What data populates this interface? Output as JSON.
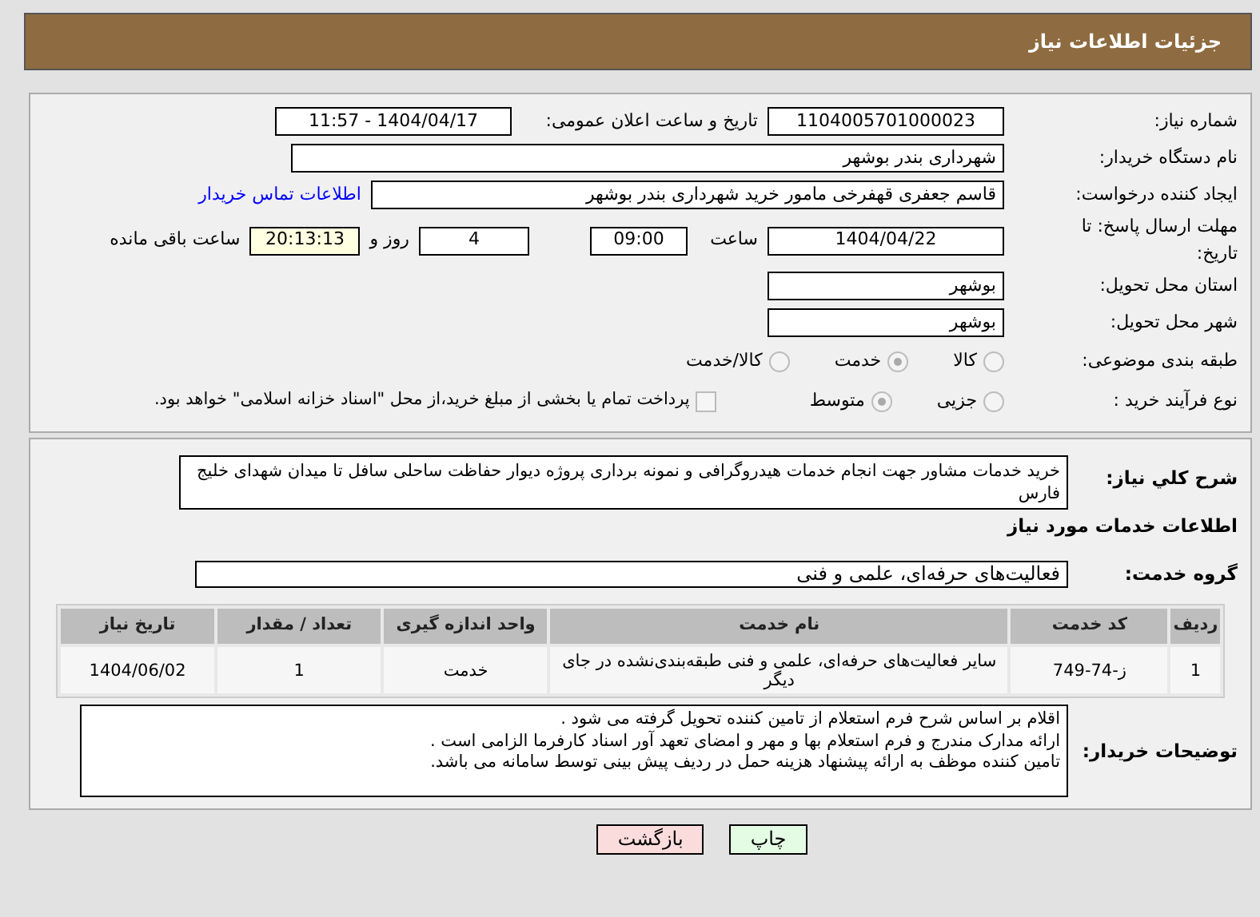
{
  "header": {
    "title": "جزئیات اطلاعات نیاز"
  },
  "need_number": {
    "label": "شماره نیاز:",
    "value": "1104005701000023"
  },
  "announce": {
    "label": "تاریخ و ساعت اعلان عمومی:",
    "value": "1404/04/17 - 11:57"
  },
  "buyer_org": {
    "label": "نام دستگاه خریدار:",
    "value": "شهرداری بندر بوشهر"
  },
  "requester": {
    "label": "ایجاد کننده درخواست:",
    "value": "قاسم جعفری قهفرخی مامور خرید  شهرداری بندر بوشهر",
    "contact_link": "اطلاعات تماس خریدار"
  },
  "deadline": {
    "label": "مهلت ارسال پاسخ: تا تاریخ:",
    "date": "1404/04/22",
    "time_label": "ساعت",
    "time": "09:00",
    "days": "4",
    "days_label": "روز و",
    "remaining": "20:13:13",
    "remaining_label": "ساعت باقی مانده"
  },
  "province": {
    "label": "استان محل تحویل:",
    "value": "بوشهر"
  },
  "city": {
    "label": "شهر محل تحویل:",
    "value": "بوشهر"
  },
  "category": {
    "label": "طبقه بندی موضوعی:",
    "options": [
      {
        "label": "کالا",
        "selected": false
      },
      {
        "label": "خدمت",
        "selected": true
      },
      {
        "label": "کالا/خدمت",
        "selected": false
      }
    ]
  },
  "process": {
    "label": "نوع فرآیند خرید :",
    "options": [
      {
        "label": "جزیی",
        "selected": false
      },
      {
        "label": "متوسط",
        "selected": true
      }
    ],
    "payment": {
      "checked": false,
      "text": "پرداخت تمام یا بخشی از مبلغ خرید،از محل \"اسناد خزانه اسلامی\" خواهد بود."
    }
  },
  "description": {
    "label": "شرح کلي نياز:",
    "value": "خرید خدمات مشاور جهت انجام خدمات هیدروگرافی و نمونه برداری پروژه دیوار حفاظت ساحلی سافل تا میدان شهدای خلیج فارس"
  },
  "services_heading": "اطلاعات خدمات مورد نیاز",
  "service_group": {
    "label": "گروه خدمت:",
    "value": "فعالیت‌های حرفه‌ای، علمی و فنی"
  },
  "table": {
    "columns": [
      "ردیف",
      "کد خدمت",
      "نام خدمت",
      "واحد اندازه گیری",
      "تعداد / مقدار",
      "تاریخ نیاز"
    ],
    "rows": [
      [
        "1",
        "ز-74-749",
        "سایر فعالیت‌های حرفه‌ای، علمی و فنی طبقه‌بندی‌نشده در جای دیگر",
        "خدمت",
        "1",
        "1404/06/02"
      ]
    ]
  },
  "buyer_notes": {
    "label": "توضیحات خریدار:",
    "lines": [
      "اقلام بر اساس شرح فرم استعلام از تامین کننده تحویل گرفته می شود .",
      "ارائه مدارک مندرج و فرم استعلام بها و مهر و امضای تعهد آور اسناد کارفرما الزامی است .",
      "تامین  کننده موظف به ارائه پیشنهاد هزینه حمل در ردیف پیش بینی توسط سامانه می باشد."
    ]
  },
  "buttons": [
    {
      "label": "چاپ",
      "kind": "print"
    },
    {
      "label": "بازگشت",
      "kind": "back"
    }
  ]
}
